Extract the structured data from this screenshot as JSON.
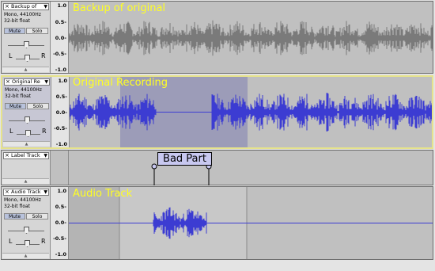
{
  "tracks": [
    {
      "title_short": "Backup of",
      "display_name": "Backup of original",
      "info_line1": "Mono, 44100Hz",
      "info_line2": "32-bit float",
      "mute_label": "Mute",
      "solo_label": "Solo",
      "left_label": "L",
      "right_label": "R",
      "ticks": [
        "1.0",
        "0.5-",
        "0.0-",
        "-0.5-",
        "-1.0"
      ],
      "wave_color": "#7a7a7a"
    },
    {
      "title_short": "Original Re",
      "display_name": "Original Recording",
      "info_line1": "Mono, 44100Hz",
      "info_line2": "32-bit float",
      "mute_label": "Mute",
      "solo_label": "Solo",
      "left_label": "L",
      "right_label": "R",
      "ticks": [
        "1.0",
        "0.5-",
        "0.0-",
        "-0.5-",
        "-1.0"
      ],
      "wave_color": "#3c3cd2"
    },
    {
      "title_short": "Label Track",
      "label_text": "Bad Part"
    },
    {
      "title_short": "Audio Track",
      "display_name": "Audio Track",
      "info_line1": "Mono, 44100Hz",
      "info_line2": "32-bit float",
      "mute_label": "Mute",
      "solo_label": "Solo",
      "left_label": "L",
      "right_label": "R",
      "ticks": [
        "1.0",
        "0.5-",
        "0.0-",
        "-0.5-",
        "-1.0"
      ],
      "wave_color": "#3c3cd2"
    }
  ],
  "colors": {
    "track_bg": "#c0c0c0",
    "selection_bg": "#9c9cb8",
    "waveform_blue": "#3c3cd2",
    "waveform_gray": "#7a7a7a",
    "track_name_yellow": "#ffff22",
    "label_box_bg": "#c8c8f0"
  },
  "icons": {
    "close": "close-icon",
    "dropdown": "dropdown-arrow-icon",
    "collapse": "collapse-arrow-icon"
  }
}
